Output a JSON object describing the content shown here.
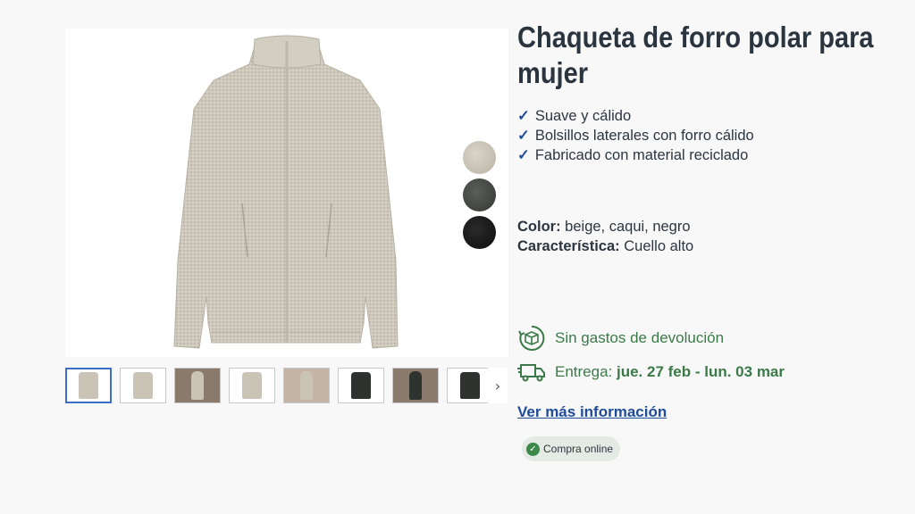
{
  "product": {
    "title": "Chaqueta de forro polar para mujer",
    "features": [
      "Suave y cálido",
      "Bolsillos laterales con forro cálido",
      "Fabricado con material reciclado"
    ],
    "color_label": "Color:",
    "color_value": "beige, caqui, negro",
    "feature_label": "Característica:",
    "feature_value": "Cuello alto"
  },
  "gallery": {
    "swatches": [
      "beige",
      "caqui",
      "negro"
    ],
    "thumbnail_count": 8,
    "next_icon": "chevron-right-icon"
  },
  "perks": {
    "returns_text": "Sin gastos de devolución",
    "delivery_label": "Entrega:",
    "delivery_dates": "jue. 27 feb - lun. 03 mar"
  },
  "links": {
    "more_info": "Ver más información"
  },
  "badge": {
    "label": "Compra online"
  },
  "colors": {
    "accent_blue": "#1f4c9a",
    "green": "#3b7a48",
    "text": "#2b3540"
  }
}
